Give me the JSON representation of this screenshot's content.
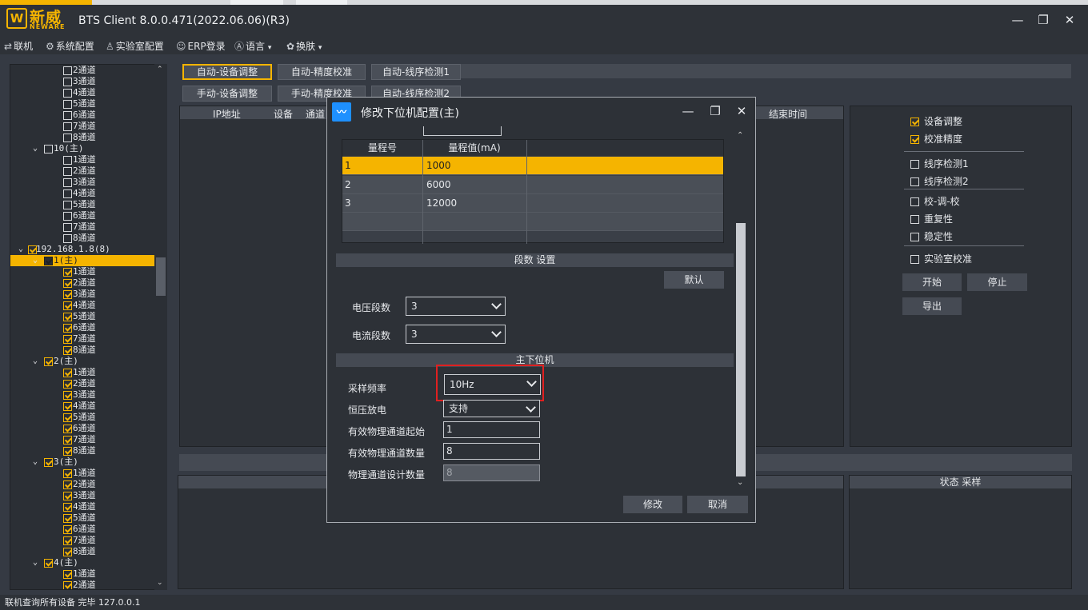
{
  "app": {
    "title": "BTS Client 8.0.0.471(2022.06.06)(R3)",
    "logo_cn": "新威",
    "logo_en": "NEWARE",
    "logo_mark": "W"
  },
  "window_controls": {
    "minimize": "—",
    "maximize": "❐",
    "close": "✕"
  },
  "menu": [
    {
      "label": "联机",
      "icon": "connect-icon"
    },
    {
      "label": "系统配置",
      "icon": "gear-icon"
    },
    {
      "label": "实验室配置",
      "icon": "flask-icon"
    },
    {
      "label": "ERP登录",
      "icon": "user-icon"
    },
    {
      "label": "语言",
      "icon": "language-icon"
    },
    {
      "label": "换肤",
      "icon": "skin-icon"
    }
  ],
  "tree": {
    "rows": [
      {
        "label": "2通道",
        "level": 2,
        "checked": false
      },
      {
        "label": "3通道",
        "level": 2,
        "checked": false
      },
      {
        "label": "4通道",
        "level": 2,
        "checked": false
      },
      {
        "label": "5通道",
        "level": 2,
        "checked": false
      },
      {
        "label": "6通道",
        "level": 2,
        "checked": false
      },
      {
        "label": "7通道",
        "level": 2,
        "checked": false
      },
      {
        "label": "8通道",
        "level": 2,
        "checked": false
      },
      {
        "label": "10(主)",
        "level": 1,
        "checked": false,
        "expanded": true
      },
      {
        "label": "1通道",
        "level": 2,
        "checked": false
      },
      {
        "label": "2通道",
        "level": 2,
        "checked": false
      },
      {
        "label": "3通道",
        "level": 2,
        "checked": false
      },
      {
        "label": "4通道",
        "level": 2,
        "checked": false
      },
      {
        "label": "5通道",
        "level": 2,
        "checked": false
      },
      {
        "label": "6通道",
        "level": 2,
        "checked": false
      },
      {
        "label": "7通道",
        "level": 2,
        "checked": false
      },
      {
        "label": "8通道",
        "level": 2,
        "checked": false
      },
      {
        "label": "192.168.1.8(8)",
        "level": 0,
        "checked": true,
        "expanded": true
      },
      {
        "label": "1(主)",
        "level": 1,
        "checked": true,
        "expanded": true,
        "selected": true
      },
      {
        "label": "1通道",
        "level": 2,
        "checked": true
      },
      {
        "label": "2通道",
        "level": 2,
        "checked": true
      },
      {
        "label": "3通道",
        "level": 2,
        "checked": true
      },
      {
        "label": "4通道",
        "level": 2,
        "checked": true
      },
      {
        "label": "5通道",
        "level": 2,
        "checked": true
      },
      {
        "label": "6通道",
        "level": 2,
        "checked": true
      },
      {
        "label": "7通道",
        "level": 2,
        "checked": true
      },
      {
        "label": "8通道",
        "level": 2,
        "checked": true
      },
      {
        "label": "2(主)",
        "level": 1,
        "checked": true,
        "expanded": true
      },
      {
        "label": "1通道",
        "level": 2,
        "checked": true
      },
      {
        "label": "2通道",
        "level": 2,
        "checked": true
      },
      {
        "label": "3通道",
        "level": 2,
        "checked": true
      },
      {
        "label": "4通道",
        "level": 2,
        "checked": true
      },
      {
        "label": "5通道",
        "level": 2,
        "checked": true
      },
      {
        "label": "6通道",
        "level": 2,
        "checked": true
      },
      {
        "label": "7通道",
        "level": 2,
        "checked": true
      },
      {
        "label": "8通道",
        "level": 2,
        "checked": true
      },
      {
        "label": "3(主)",
        "level": 1,
        "checked": true,
        "expanded": true
      },
      {
        "label": "1通道",
        "level": 2,
        "checked": true
      },
      {
        "label": "2通道",
        "level": 2,
        "checked": true
      },
      {
        "label": "3通道",
        "level": 2,
        "checked": true
      },
      {
        "label": "4通道",
        "level": 2,
        "checked": true
      },
      {
        "label": "5通道",
        "level": 2,
        "checked": true
      },
      {
        "label": "6通道",
        "level": 2,
        "checked": true
      },
      {
        "label": "7通道",
        "level": 2,
        "checked": true
      },
      {
        "label": "8通道",
        "level": 2,
        "checked": true
      },
      {
        "label": "4(主)",
        "level": 1,
        "checked": true,
        "expanded": true
      },
      {
        "label": "1通道",
        "level": 2,
        "checked": true
      },
      {
        "label": "2通道",
        "level": 2,
        "checked": true
      }
    ]
  },
  "tabs_row1": [
    "自动-设备调整",
    "自动-精度校准",
    "自动-线序检测1"
  ],
  "tabs_row2": [
    "手动-设备调整",
    "手动-精度校准",
    "自动-线序检测2"
  ],
  "table_headers": {
    "ip": "IP地址",
    "device": "设备",
    "channel": "通道",
    "end_time": "结束时间"
  },
  "bottom_right_header": "状态 采样",
  "options": [
    {
      "label": "设备调整",
      "checked": true
    },
    {
      "label": "校准精度",
      "checked": true
    },
    {
      "label": "线序检测1",
      "checked": false
    },
    {
      "label": "线序检测2",
      "checked": false
    },
    {
      "label": "校-调-校",
      "checked": false
    },
    {
      "label": "重复性",
      "checked": false
    },
    {
      "label": "稳定性",
      "checked": false
    },
    {
      "label": "实验室校准",
      "checked": false
    }
  ],
  "right_buttons": {
    "start": "开始",
    "stop": "停止",
    "export": "导出"
  },
  "status": "联机查询所有设备 完毕 127.0.0.1",
  "dialog": {
    "title": "修改下位机配置(主)",
    "grid": {
      "headers": [
        "量程号",
        "量程值(mA)"
      ],
      "rows": [
        [
          "1",
          "1000"
        ],
        [
          "2",
          "6000"
        ],
        [
          "3",
          "12000"
        ]
      ]
    },
    "segment_header": "段数 设置",
    "default_button": "默认",
    "voltage_label": "电压段数",
    "voltage_value": "3",
    "current_label": "电流段数",
    "current_value": "3",
    "main_header": "主下位机",
    "sample_label": "采样频率",
    "sample_value": "10Hz",
    "cv_label": "恒压放电",
    "cv_value": "支持",
    "start_label": "有效物理通道起始",
    "start_value": "1",
    "count_label": "有效物理通道数量",
    "count_value": "8",
    "design_label": "物理通道设计数量",
    "design_value": "8",
    "modify_button": "修改",
    "cancel_button": "取消"
  }
}
